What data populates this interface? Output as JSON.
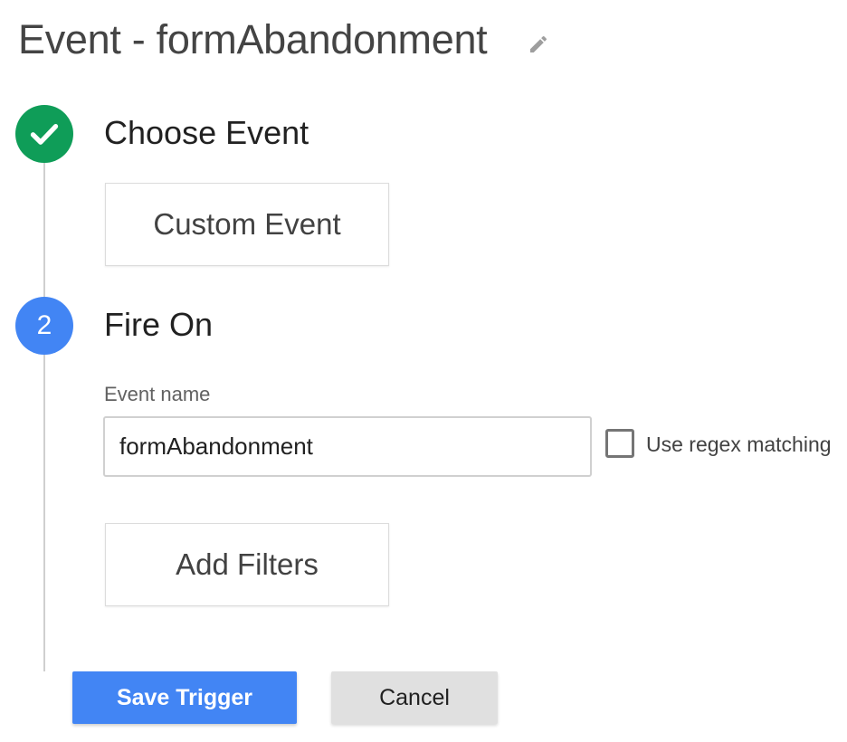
{
  "header": {
    "title": "Event - formAbandonment",
    "edit_icon": "pencil-icon"
  },
  "steps": [
    {
      "number": "1",
      "status": "completed",
      "icon": "check-icon",
      "label": "Choose Event",
      "selection_label": "Custom Event",
      "color": "#0f9d58"
    },
    {
      "number": "2",
      "status": "active",
      "label": "Fire On",
      "color": "#4285f4",
      "event_name": {
        "label": "Event name",
        "value": "formAbandonment",
        "placeholder": ""
      },
      "regex": {
        "label": "Use regex matching",
        "checked": false
      },
      "add_filters_label": "Add Filters"
    }
  ],
  "actions": {
    "save_label": "Save Trigger",
    "cancel_label": "Cancel",
    "save_color": "#4285f4"
  }
}
